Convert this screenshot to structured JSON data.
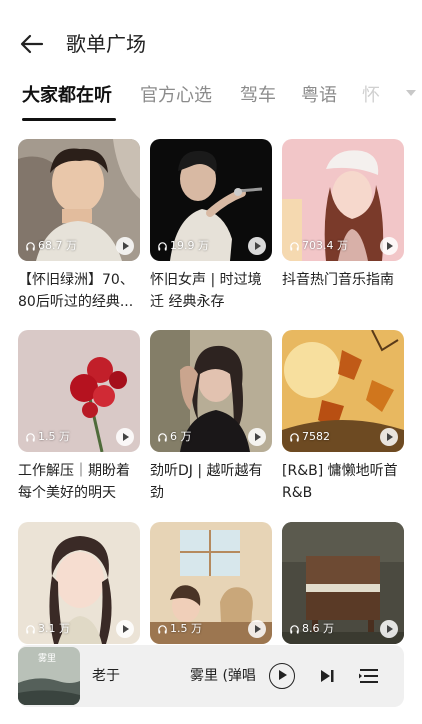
{
  "header": {
    "title": "歌单广场"
  },
  "tabs": [
    {
      "label": "大家都在听",
      "active": true
    },
    {
      "label": "官方心选"
    },
    {
      "label": "驾车"
    },
    {
      "label": "粤语"
    },
    {
      "label": "怀"
    }
  ],
  "cards": [
    {
      "plays": "68.7 万",
      "caption": "【怀旧绿洲】70、80后听过的经典...",
      "icon": "portrait-man-cover"
    },
    {
      "plays": "19.9 万",
      "caption": "怀旧女声 | 时过境迁 经典永存",
      "icon": "singer-microphone-cover"
    },
    {
      "plays": "703.4 万",
      "caption": "抖音热门音乐指南",
      "icon": "girl-white-hat-cover"
    },
    {
      "plays": "1.5 万",
      "caption": "工作解压｜期盼着每个美好的明天",
      "icon": "red-flowers-cover"
    },
    {
      "plays": "6 万",
      "caption": "劲听DJ | 越听越有劲",
      "icon": "tattoo-woman-cover"
    },
    {
      "plays": "7582",
      "caption": "[R&B] 慵懒地听首R&B",
      "icon": "autumn-leaves-cover"
    },
    {
      "plays": "3.1 万",
      "caption": "",
      "icon": "anime-girl-cover"
    },
    {
      "plays": "1.5 万",
      "caption": "",
      "icon": "anime-room-cover"
    },
    {
      "plays": "8.6 万",
      "caption": "",
      "icon": "old-piano-cover"
    }
  ],
  "player": {
    "song": "老于",
    "song2": "雾里 (弹唱",
    "art_text": "雾里"
  }
}
